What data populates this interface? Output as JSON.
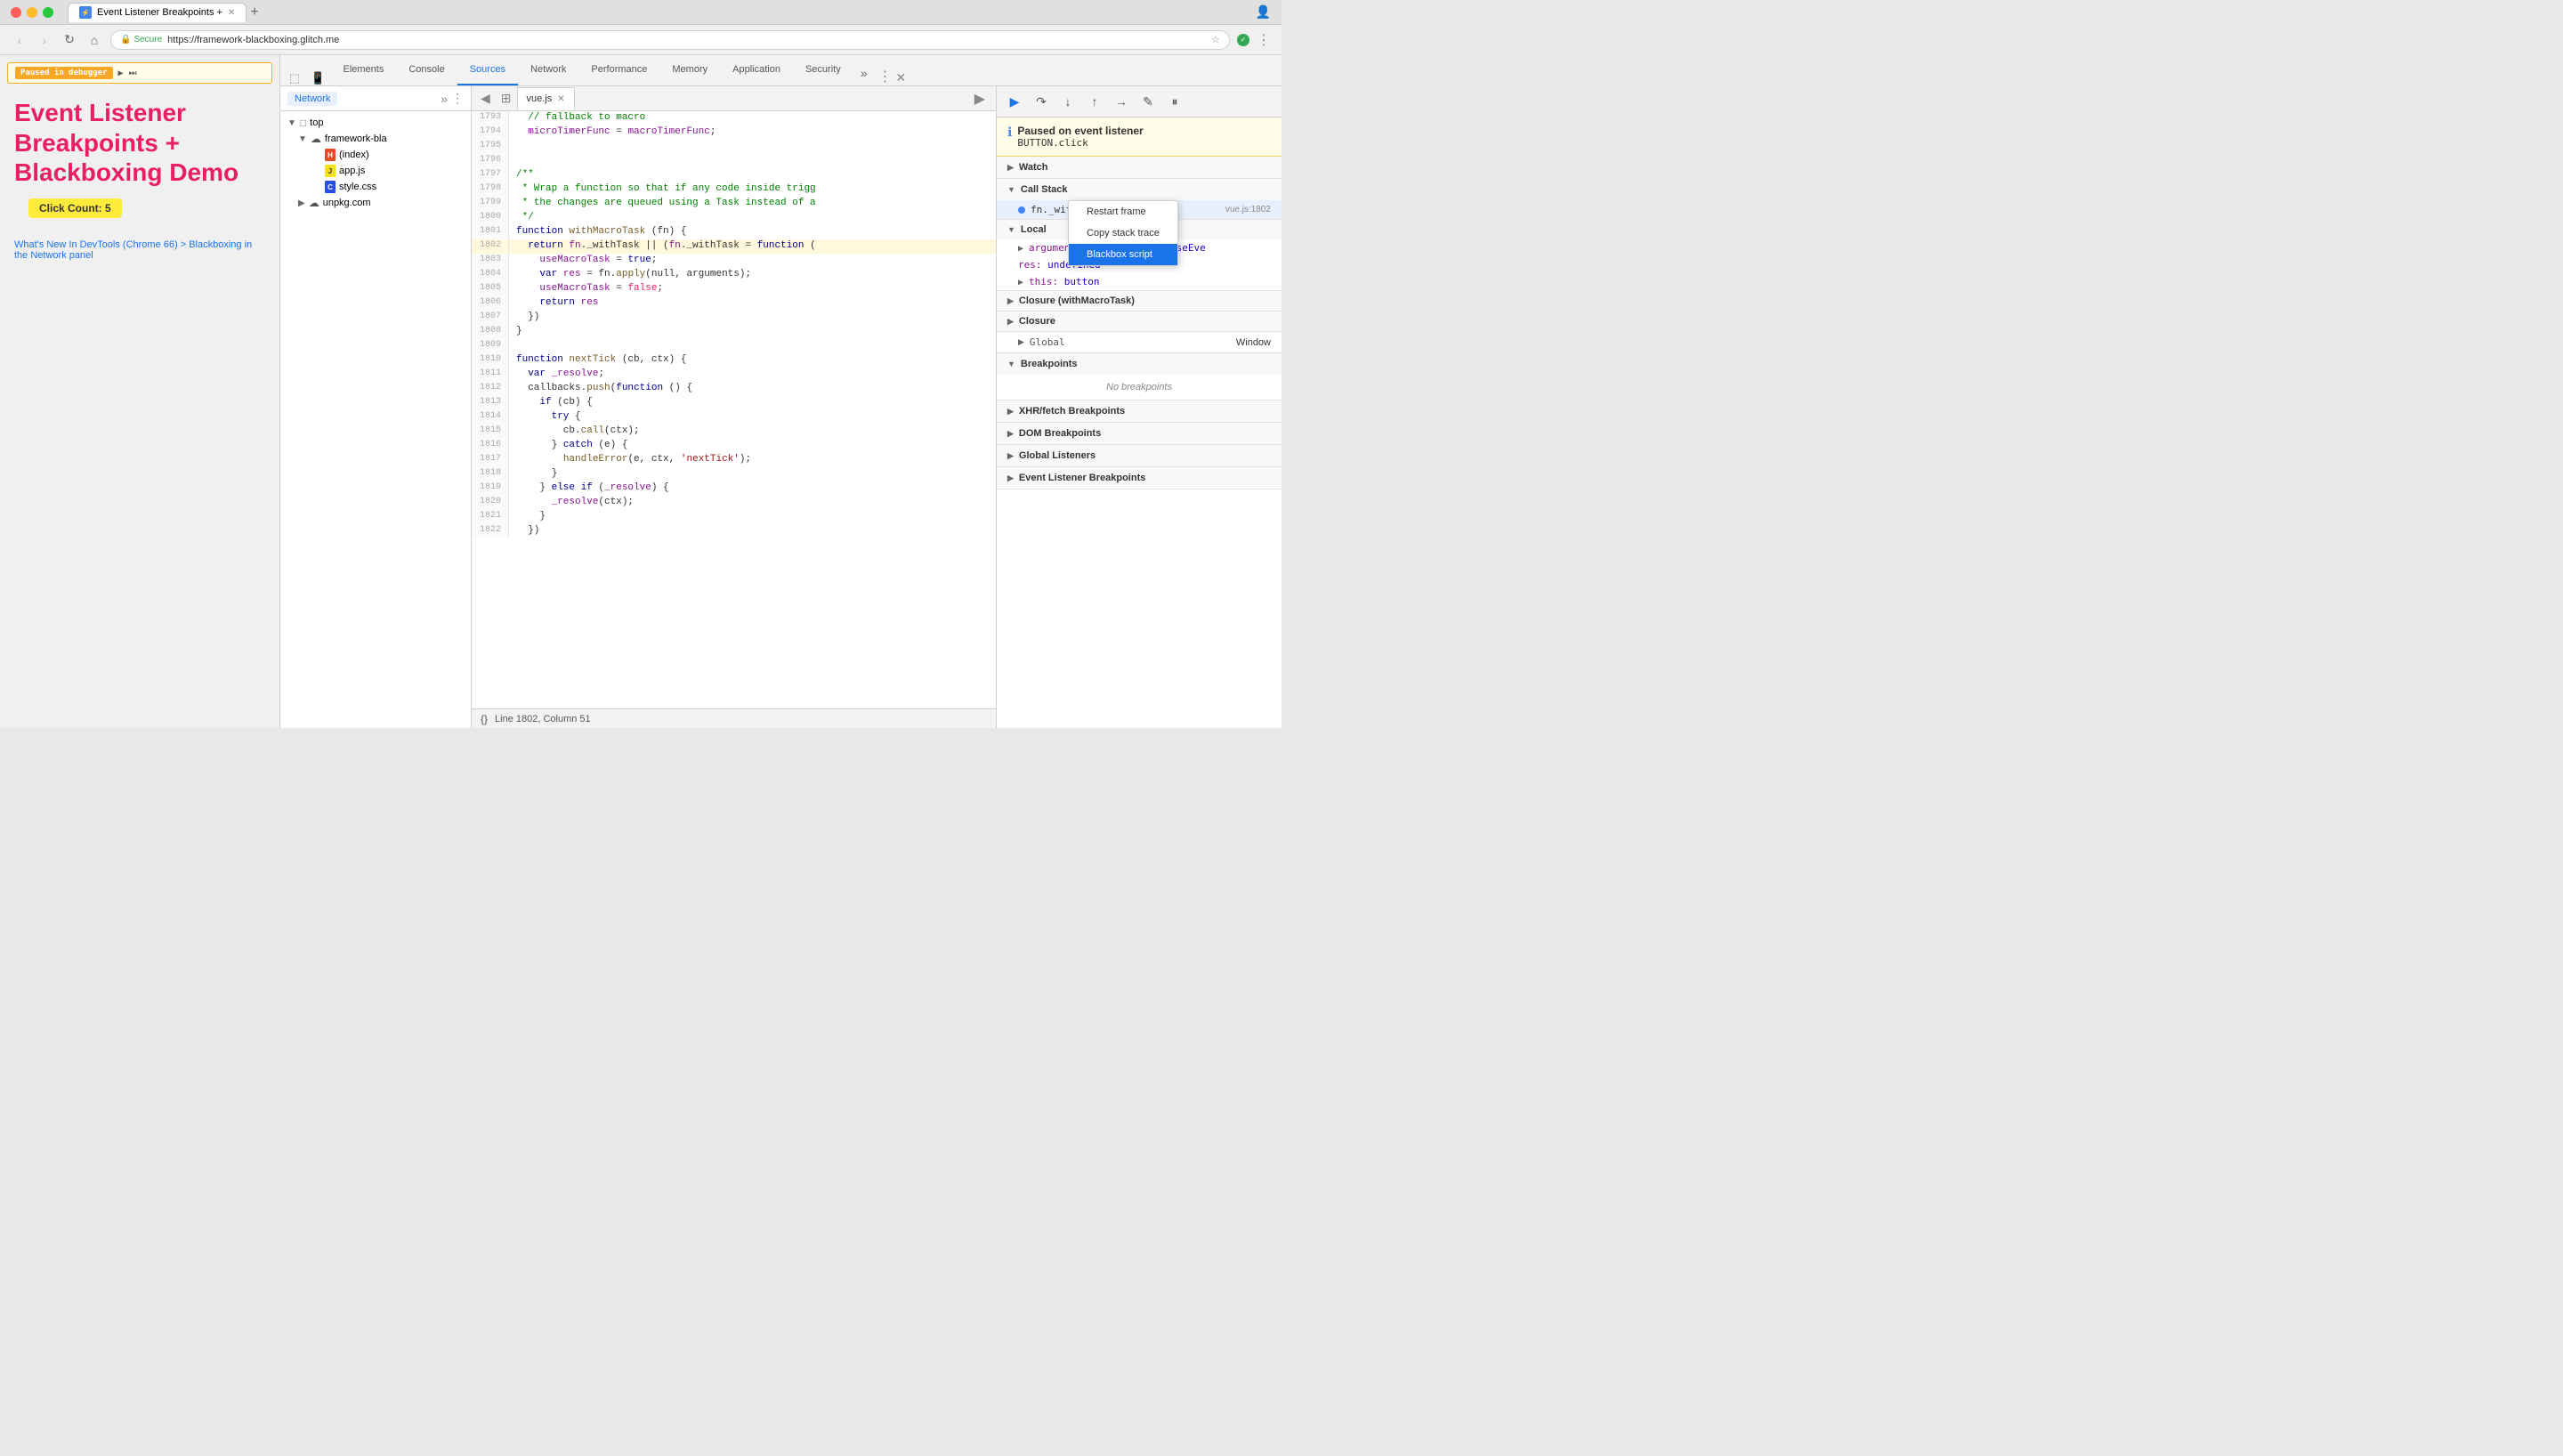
{
  "browser": {
    "tab_title": "Event Listener Breakpoints +",
    "url_secure": "Secure",
    "url": "https://framework-blackboxing.glitch.me"
  },
  "page": {
    "paused_label": "Paused in debugger",
    "title": "Event Listener Breakpoints + Blackboxing Demo",
    "click_count": "Click Count: 5",
    "links": [
      "What's New In DevTools (Chrome 66) > Blackboxing in the Network panel"
    ]
  },
  "devtools": {
    "tabs": [
      "Elements",
      "Console",
      "Sources",
      "Network",
      "Performance",
      "Memory",
      "Application",
      "Security"
    ],
    "active_tab": "Sources"
  },
  "sources_panel": {
    "tab": "Network",
    "tree": [
      {
        "label": "top",
        "indent": 0,
        "type": "folder",
        "open": true
      },
      {
        "label": "framework-bla",
        "indent": 1,
        "type": "cloud-folder",
        "open": true
      },
      {
        "label": "(index)",
        "indent": 2,
        "type": "html"
      },
      {
        "label": "app.js",
        "indent": 2,
        "type": "js"
      },
      {
        "label": "style.css",
        "indent": 2,
        "type": "css"
      },
      {
        "label": "unpkg.com",
        "indent": 1,
        "type": "cloud-folder",
        "open": false
      }
    ]
  },
  "editor": {
    "filename": "vue.js",
    "lines": [
      {
        "num": 1793,
        "text": "  // fallback to macro",
        "type": "comment"
      },
      {
        "num": 1794,
        "text": "  microTimerFunc = macroTimerFunc;",
        "type": "code"
      },
      {
        "num": 1795,
        "text": "",
        "type": "code"
      },
      {
        "num": 1796,
        "text": "",
        "type": "code"
      },
      {
        "num": 1797,
        "text": "/**",
        "type": "comment"
      },
      {
        "num": 1798,
        "text": " * Wrap a function so that if any code inside trigg",
        "type": "comment"
      },
      {
        "num": 1799,
        "text": " * the changes are queued using a Task instead of a",
        "type": "comment"
      },
      {
        "num": 1800,
        "text": " */",
        "type": "comment"
      },
      {
        "num": 1801,
        "text": "function withMacroTask (fn) {",
        "type": "code"
      },
      {
        "num": 1802,
        "text": "  return fn._withTask || (fn._withTask = function (",
        "type": "highlighted"
      },
      {
        "num": 1803,
        "text": "    useMacroTask = true;",
        "type": "code"
      },
      {
        "num": 1804,
        "text": "    var res = fn.apply(null, arguments);",
        "type": "code"
      },
      {
        "num": 1805,
        "text": "    useMacroTask = false;",
        "type": "code"
      },
      {
        "num": 1806,
        "text": "    return res",
        "type": "code"
      },
      {
        "num": 1807,
        "text": "  })",
        "type": "code"
      },
      {
        "num": 1808,
        "text": "}",
        "type": "code"
      },
      {
        "num": 1809,
        "text": "",
        "type": "code"
      },
      {
        "num": 1810,
        "text": "function nextTick (cb, ctx) {",
        "type": "code"
      },
      {
        "num": 1811,
        "text": "  var _resolve;",
        "type": "code"
      },
      {
        "num": 1812,
        "text": "  callbacks.push(function () {",
        "type": "code"
      },
      {
        "num": 1813,
        "text": "    if (cb) {",
        "type": "code"
      },
      {
        "num": 1814,
        "text": "      try {",
        "type": "code"
      },
      {
        "num": 1815,
        "text": "        cb.call(ctx);",
        "type": "code"
      },
      {
        "num": 1816,
        "text": "      } catch (e) {",
        "type": "code"
      },
      {
        "num": 1817,
        "text": "        handleError(e, ctx, 'nextTick');",
        "type": "code"
      },
      {
        "num": 1818,
        "text": "      }",
        "type": "code"
      },
      {
        "num": 1819,
        "text": "    } else if (_resolve) {",
        "type": "code"
      },
      {
        "num": 1820,
        "text": "      _resolve(ctx);",
        "type": "code"
      },
      {
        "num": 1821,
        "text": "    }",
        "type": "code"
      },
      {
        "num": 1822,
        "text": "  })",
        "type": "code"
      }
    ],
    "footer": "Line 1802, Column 51"
  },
  "debugger": {
    "paused_on": "Paused on event listener",
    "paused_detail": "BUTTON.click",
    "sections": {
      "watch": "Watch",
      "call_stack": "Call Stack",
      "call_stack_items": [
        {
          "name": "fn._withTask.fn._withTask",
          "location": "vue.js:1802",
          "active": true
        }
      ],
      "context_menu": {
        "items": [
          "Restart frame",
          "Copy stack trace",
          "Blackbox script"
        ],
        "active": "Blackbox script"
      },
      "scope": {
        "local_label": "Local",
        "local_items": [
          {
            "key": "arguments:",
            "val": "Arguments [MouseEve"
          },
          {
            "key": "res:",
            "val": "undefined"
          },
          {
            "key": "this:",
            "val": "button"
          }
        ],
        "closure_labels": [
          "Closure (withMacroTask)",
          "Closure"
        ],
        "global_label": "Global",
        "global_val": "Window"
      },
      "breakpoints": "Breakpoints",
      "no_breakpoints": "No breakpoints",
      "xhr_breakpoints": "XHR/fetch Breakpoints",
      "dom_breakpoints": "DOM Breakpoints",
      "global_listeners": "Global Listeners",
      "event_listener_breakpoints": "Event Listener Breakpoints"
    }
  }
}
